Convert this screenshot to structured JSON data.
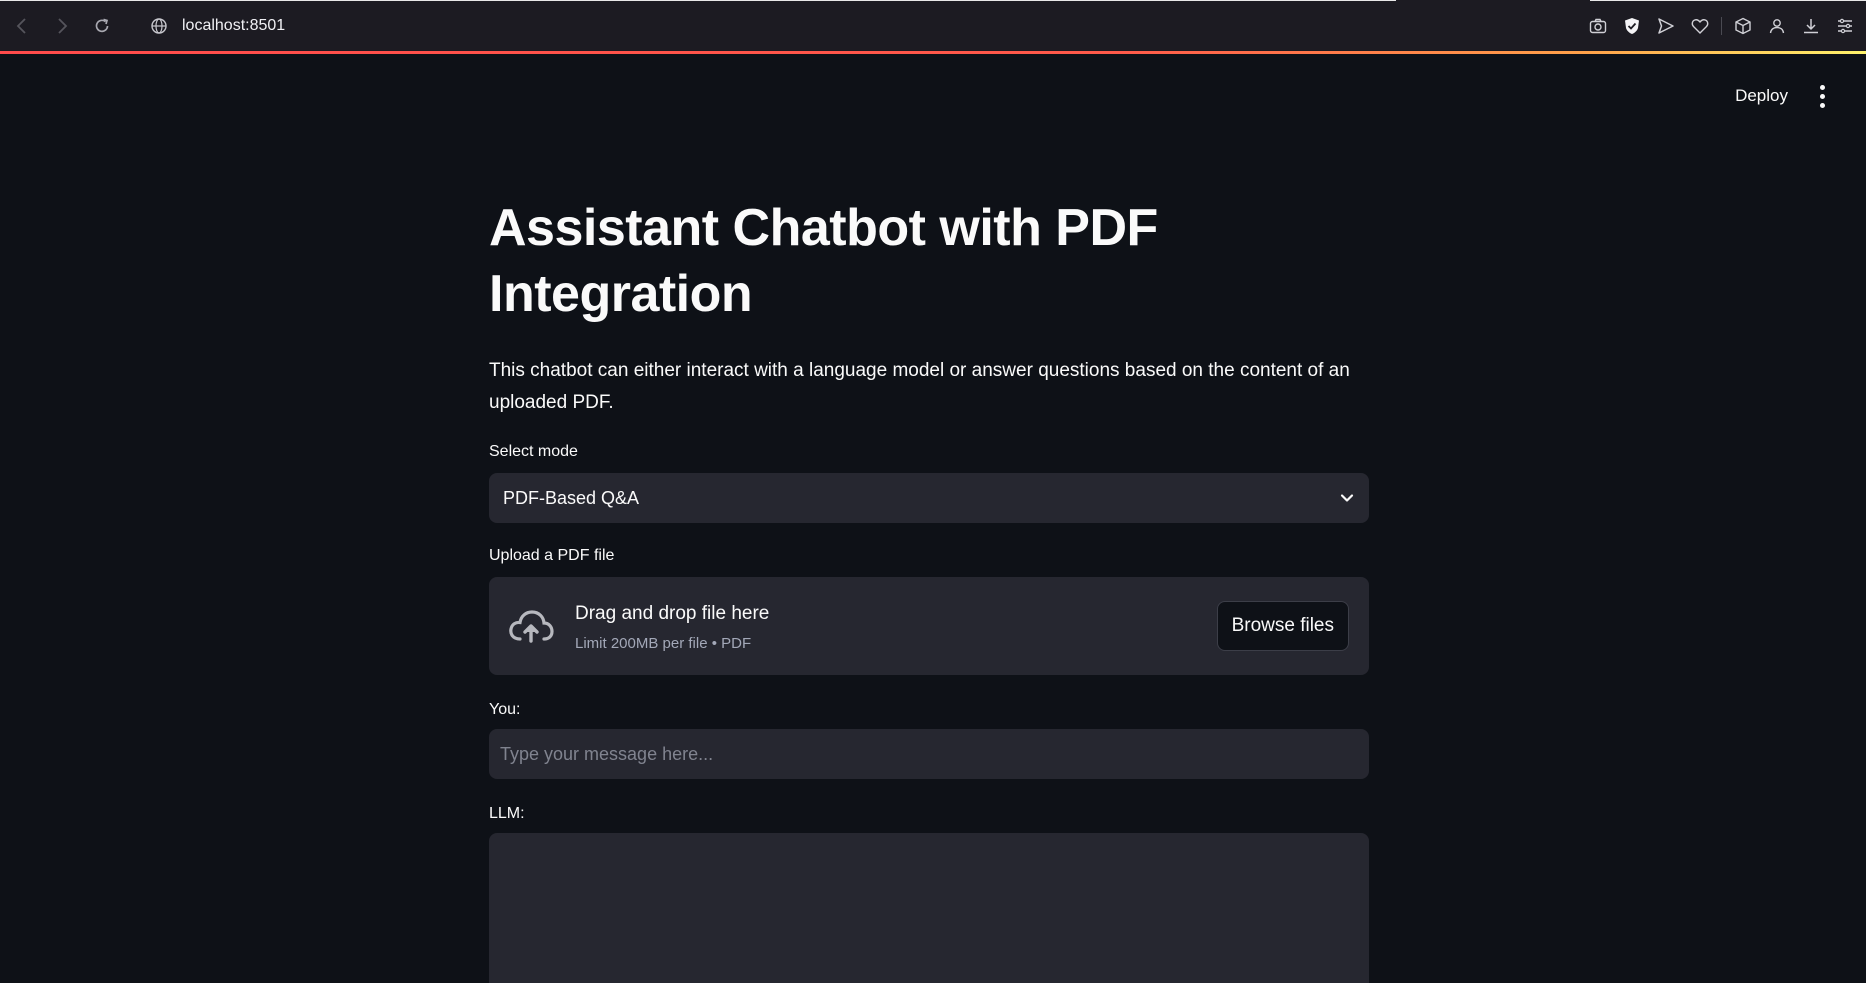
{
  "browser": {
    "url": "localhost:8501"
  },
  "header": {
    "deploy_label": "Deploy"
  },
  "main": {
    "title": "Assistant Chatbot with PDF Integration",
    "description": "This chatbot can either interact with a language model or answer questions based on the content of an uploaded PDF.",
    "mode_label": "Select mode",
    "mode_value": "PDF-Based Q&A",
    "upload_label": "Upload a PDF file",
    "dropzone_title": "Drag and drop file here",
    "dropzone_limit": "Limit 200MB per file • PDF",
    "browse_label": "Browse files",
    "you_label": "You:",
    "input_placeholder": "Type your message here...",
    "llm_label": "LLM:"
  },
  "icons": {
    "back": "arrow-left-icon",
    "forward": "arrow-right-icon",
    "reload": "reload-icon",
    "site": "globe-icon",
    "toolbar": [
      "camera-icon",
      "shield-icon",
      "send-icon",
      "heart-icon",
      "cube-icon",
      "account-icon",
      "download-icon",
      "menu-icon"
    ]
  },
  "colors": {
    "background": "#0e1117",
    "widget": "#262730",
    "accent": "#ff4b4b"
  }
}
